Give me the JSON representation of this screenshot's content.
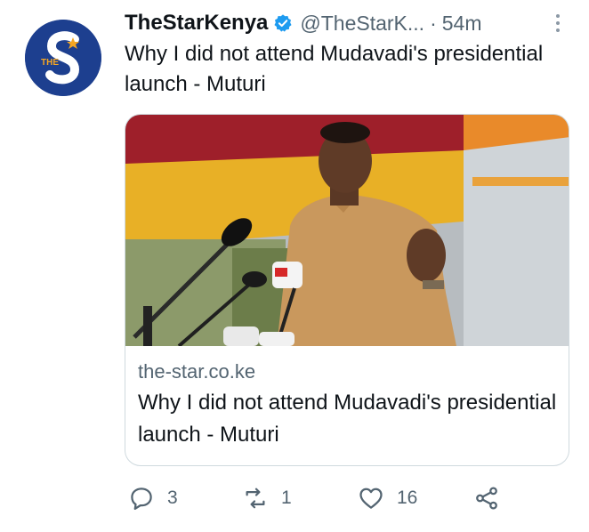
{
  "tweet": {
    "author": {
      "display_name": "TheStarKenya",
      "handle": "@TheStarK...",
      "avatar_text": "THE",
      "verified_icon": "verified-badge-icon"
    },
    "separator": "·",
    "time_ago": "54m",
    "text": "Why I did not attend Mudavadi's presidential launch - Muturi",
    "card": {
      "domain": "the-star.co.ke",
      "title": "Why I did not attend Mudavadi's presidential launch - Muturi"
    },
    "actions": {
      "reply_count": "3",
      "retweet_count": "1",
      "like_count": "16"
    }
  },
  "colors": {
    "brand_blue": "#1d3f8f",
    "verified_blue": "#1d9bf0",
    "secondary_text": "#536471",
    "border": "#cfd9de"
  },
  "icons": {
    "more": "more-dots-icon",
    "reply": "reply-icon",
    "retweet": "retweet-icon",
    "like": "heart-icon",
    "share": "share-icon"
  }
}
